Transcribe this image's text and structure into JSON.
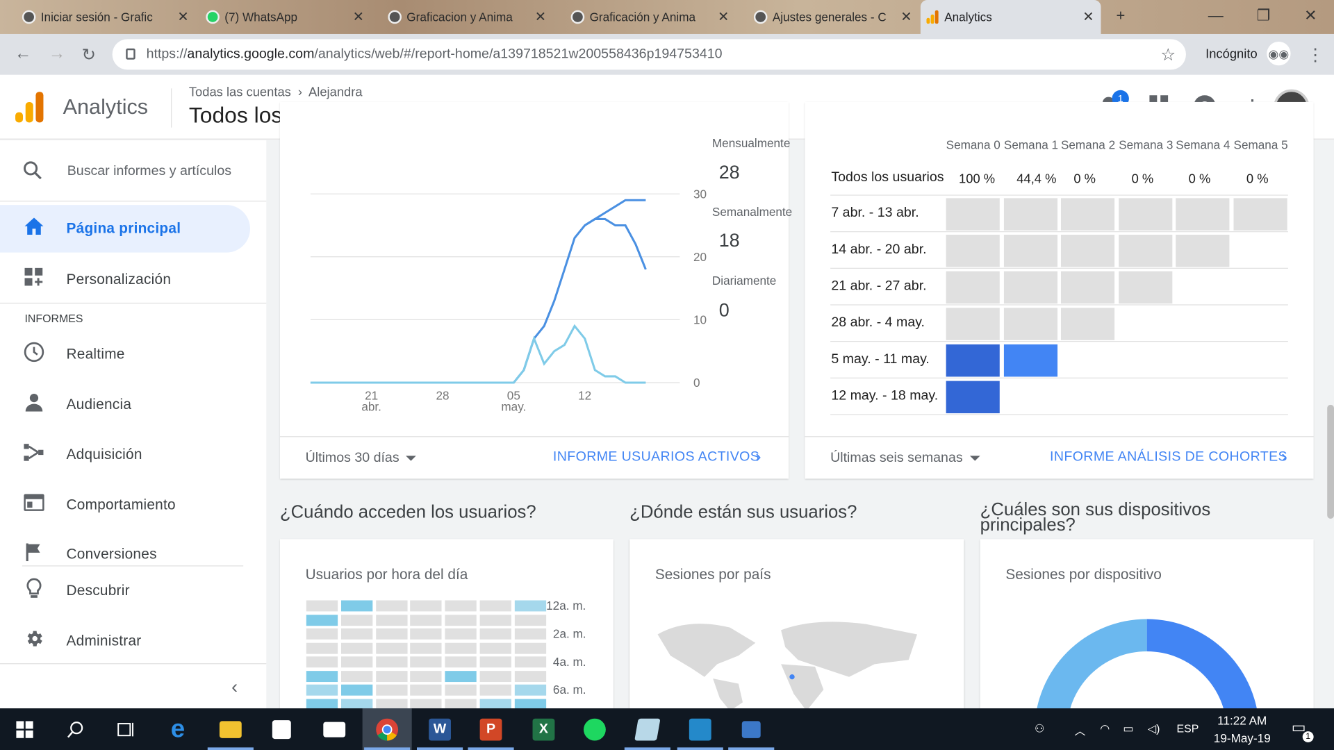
{
  "browser": {
    "tabs": [
      {
        "title": "Iniciar sesión - Grafic"
      },
      {
        "title": "(7) WhatsApp"
      },
      {
        "title": "Graficacion y Anima"
      },
      {
        "title": "Graficación y Anima"
      },
      {
        "title": "Ajustes generales - C"
      },
      {
        "title": "Analytics"
      }
    ],
    "url_scheme": "https://",
    "url_host": "analytics.google.com",
    "url_path": "/analytics/web/#/report-home/a139718521w200558436p194753410",
    "incognito_label": "Incógnito"
  },
  "header": {
    "app_name": "Analytics",
    "breadcrumb_root": "Todas las cuentas",
    "breadcrumb_account": "Alejandra",
    "view_name": "Todos los datos de sitios web",
    "notification_count": "1"
  },
  "sidebar": {
    "search_placeholder": "Buscar informes y artículos",
    "home": "Página principal",
    "custom": "Personalización",
    "section": "INFORMES",
    "items": [
      "Realtime",
      "Audiencia",
      "Adquisición",
      "Comportamiento",
      "Conversiones"
    ],
    "discover": "Descubrir",
    "admin": "Administrar"
  },
  "active_users": {
    "monthly_label": "Mensualmente",
    "monthly_value": "28",
    "weekly_label": "Semanalmente",
    "weekly_value": "18",
    "daily_label": "Diariamente",
    "daily_value": "0",
    "period": "Últimos 30 días",
    "report_link": "INFORME USUARIOS ACTIVOS"
  },
  "chart_data": {
    "type": "line",
    "x_ticks": [
      "21\nabr.",
      "28",
      "05\nmay.",
      "12"
    ],
    "y_ticks": [
      0,
      10,
      20,
      30
    ],
    "ylim": [
      0,
      40
    ],
    "x": [
      "Apr 15",
      "Apr 16",
      "Apr 17",
      "Apr 18",
      "Apr 19",
      "Apr 20",
      "Apr 21",
      "Apr 22",
      "Apr 23",
      "Apr 24",
      "Apr 25",
      "Apr 26",
      "Apr 27",
      "Apr 28",
      "Apr 29",
      "Apr 30",
      "May 1",
      "May 2",
      "May 3",
      "May 4",
      "May 5",
      "May 6",
      "May 7",
      "May 8",
      "May 9",
      "May 10",
      "May 11",
      "May 12",
      "May 13",
      "May 14",
      "May 15",
      "May 16",
      "May 17",
      "May 18"
    ],
    "series": [
      {
        "color": "#4a90e2",
        "values": [
          0,
          0,
          0,
          0,
          0,
          0,
          0,
          0,
          0,
          0,
          0,
          0,
          0,
          0,
          0,
          0,
          0,
          0,
          0,
          0,
          0,
          2,
          7,
          9,
          13,
          18,
          23,
          25,
          26,
          27,
          28,
          29,
          29,
          29
        ]
      },
      {
        "color": "#4a90e2",
        "values": [
          null,
          null,
          null,
          null,
          null,
          null,
          null,
          null,
          null,
          null,
          null,
          null,
          null,
          null,
          null,
          null,
          null,
          null,
          null,
          null,
          null,
          null,
          null,
          null,
          null,
          null,
          null,
          25,
          26,
          26,
          25,
          25,
          22,
          18
        ]
      },
      {
        "color": "#7fcbe8",
        "values": [
          0,
          0,
          0,
          0,
          0,
          0,
          0,
          0,
          0,
          0,
          0,
          0,
          0,
          0,
          0,
          0,
          0,
          0,
          0,
          0,
          0,
          2,
          7,
          3,
          5,
          6,
          9,
          7,
          2,
          1,
          1,
          0,
          0,
          0
        ]
      }
    ]
  },
  "cohort": {
    "weeks": [
      "Semana 0",
      "Semana 1",
      "Semana 2",
      "Semana 3",
      "Semana 4",
      "Semana 5"
    ],
    "all_users_label": "Todos los usuarios",
    "all_users_pct": [
      "100 %",
      "44,4 %",
      "0 %",
      "0 %",
      "0 %",
      "0 %"
    ],
    "rows": [
      {
        "label": "7 abr. - 13 abr.",
        "cells": 6
      },
      {
        "label": "14 abr. - 20 abr.",
        "cells": 5
      },
      {
        "label": "21 abr. - 27 abr.",
        "cells": 4
      },
      {
        "label": "28 abr. - 4 may.",
        "cells": 3
      },
      {
        "label": "5 may. - 11 may.",
        "cells": 2
      },
      {
        "label": "12 may. - 18 may.",
        "cells": 1
      }
    ],
    "period": "Últimas seis semanas",
    "report_link": "INFORME ANÁLISIS DE COHORTES"
  },
  "questions": {
    "when": "¿Cuándo acceden los usuarios?",
    "where": "¿Dónde están sus usuarios?",
    "devices": "¿Cuáles son sus dispositivos principales?"
  },
  "cards": {
    "hourly_title": "Usuarios por hora del día",
    "hour_labels": [
      "12a. m.",
      "2a. m.",
      "4a. m.",
      "6a. m."
    ],
    "country_title": "Sesiones por país",
    "device_title": "Sesiones por dispositivo"
  },
  "taskbar": {
    "language": "ESP",
    "time": "11:22 AM",
    "date": "19-May-19",
    "notifications": "1"
  }
}
